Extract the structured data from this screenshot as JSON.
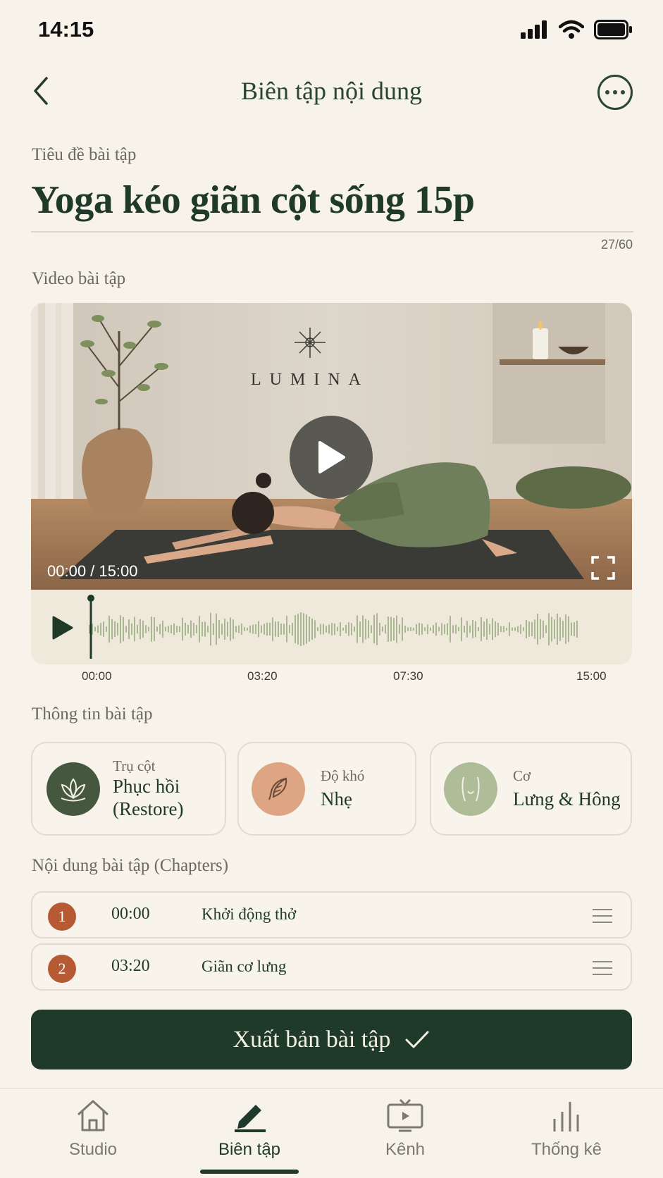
{
  "status": {
    "time": "14:15"
  },
  "header": {
    "title": "Biên tập nội dung"
  },
  "title_field": {
    "label": "Tiêu đề bài tập",
    "value": "Yoga kéo giãn cột sống 15p",
    "counter": "27/60"
  },
  "video": {
    "label": "Video bài tập",
    "brand": "LUMINA",
    "time_display": "00:00 / 15:00",
    "progress": 0
  },
  "timeline": {
    "ticks": [
      "00:00",
      "03:20",
      "07:30",
      "15:00"
    ]
  },
  "info": {
    "label": "Thông tin bài tập",
    "pillar": {
      "caption": "Trụ cột",
      "value_line1": "Phục hồi",
      "value_line2": "(Restore)",
      "icon": "lotus-icon"
    },
    "difficulty": {
      "caption": "Độ khó",
      "value": "Nhẹ",
      "icon": "feather-icon"
    },
    "muscle": {
      "caption": "Cơ",
      "value": "Lưng & Hông",
      "icon": "torso-icon"
    }
  },
  "chapters": {
    "label": "Nội dung bài tập (Chapters)",
    "items": [
      {
        "num": "1",
        "time": "00:00",
        "title": "Khởi động thở"
      },
      {
        "num": "2",
        "time": "03:20",
        "title": "Giãn cơ lưng"
      }
    ]
  },
  "publish": {
    "label": "Xuất bản bài tập"
  },
  "tabs": [
    {
      "label": "Studio",
      "icon": "home-icon"
    },
    {
      "label": "Biên tập",
      "icon": "pen-icon",
      "active": true
    },
    {
      "label": "Kênh",
      "icon": "tv-icon"
    },
    {
      "label": "Thống kê",
      "icon": "bar-chart-icon"
    }
  ],
  "colors": {
    "primary": "#1f3a28",
    "accent": "#b65a33",
    "background": "#f7f3ea"
  }
}
